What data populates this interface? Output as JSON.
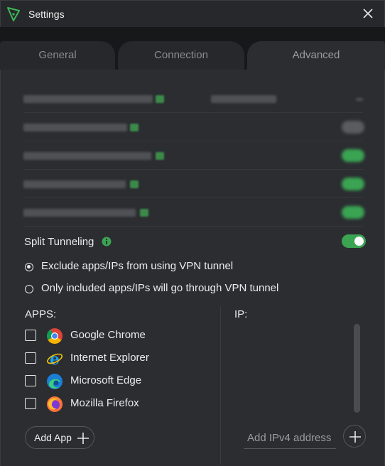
{
  "window": {
    "title": "Settings"
  },
  "tabs": [
    {
      "label": "General"
    },
    {
      "label": "Connection"
    },
    {
      "label": "Advanced",
      "active": true
    }
  ],
  "split_tunneling": {
    "label": "Split Tunneling",
    "enabled": true,
    "accent": "#3aa452",
    "options": [
      {
        "label": "Exclude apps/IPs from using VPN tunnel",
        "selected": true
      },
      {
        "label": "Only included apps/IPs will go through VPN tunnel",
        "selected": false
      }
    ]
  },
  "apps": {
    "header": "APPS:",
    "items": [
      {
        "name": "Google Chrome",
        "icon": "chrome-icon",
        "checked": false
      },
      {
        "name": "Internet Explorer",
        "icon": "internet-explorer-icon",
        "checked": false
      },
      {
        "name": "Microsoft Edge",
        "icon": "edge-icon",
        "checked": false
      },
      {
        "name": "Mozilla Firefox",
        "icon": "firefox-icon",
        "checked": false
      }
    ],
    "add_button": "Add App"
  },
  "ip": {
    "header": "IP:",
    "placeholder": "Add IPv4 address"
  }
}
